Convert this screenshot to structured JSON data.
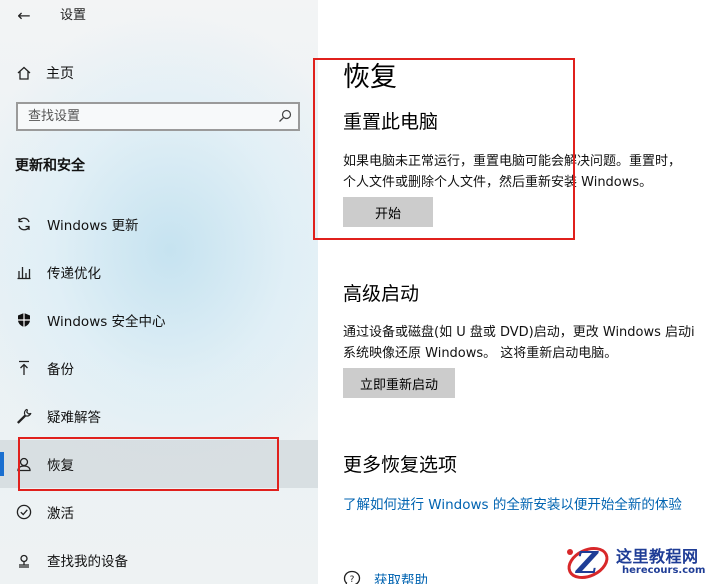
{
  "app": {
    "title": "设置",
    "back_label": "←"
  },
  "sidebar": {
    "home_label": "主页",
    "search_placeholder": "查找设置",
    "section_title": "更新和安全",
    "items": [
      {
        "label": "Windows 更新",
        "icon": "sync-icon"
      },
      {
        "label": "传递优化",
        "icon": "delivery-optimization-icon"
      },
      {
        "label": "Windows 安全中心",
        "icon": "shield-icon"
      },
      {
        "label": "备份",
        "icon": "backup-arrow-icon"
      },
      {
        "label": "疑难解答",
        "icon": "wrench-icon"
      },
      {
        "label": "恢复",
        "icon": "recovery-icon",
        "selected": true
      },
      {
        "label": "激活",
        "icon": "check-circle-icon"
      },
      {
        "label": "查找我的设备",
        "icon": "find-device-icon"
      }
    ]
  },
  "main": {
    "title": "恢复",
    "reset": {
      "heading": "重置此电脑",
      "desc_line1": "如果电脑未正常运行，重置电脑可能会解决问题。重置时，",
      "desc_line2": "个人文件或删除个人文件，然后重新安装 Windows。",
      "button": "开始"
    },
    "advanced": {
      "heading": "高级启动",
      "desc_line1": "通过设备或磁盘(如 U 盘或 DVD)启动，更改 Windows 启动i",
      "desc_line2": "系统映像还原 Windows。 这将重新启动电脑。",
      "button": "立即重新启动"
    },
    "more": {
      "heading": "更多恢复选项",
      "link": "了解如何进行 Windows 的全新安装以便开始全新的体验"
    },
    "help_link": "获取帮助"
  },
  "watermark": {
    "title": "这里教程网",
    "url": "herecours.com",
    "letter": "Z"
  },
  "colors": {
    "accent": "#0063b1",
    "highlight_box": "#e0201c",
    "button_bg": "#cccccc",
    "selection_bar": "#1a6fd0"
  }
}
